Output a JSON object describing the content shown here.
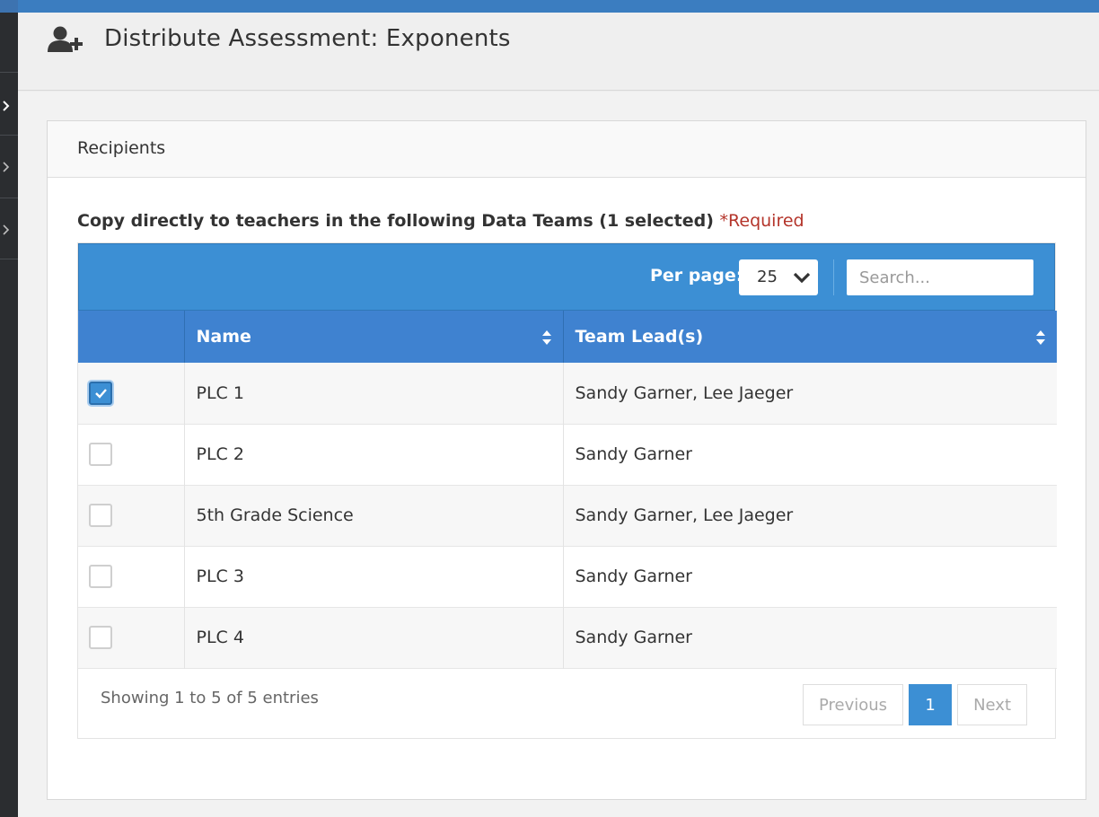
{
  "header": {
    "title": "Distribute Assessment: Exponents",
    "icon": "add-user-icon"
  },
  "panel": {
    "heading": "Recipients",
    "instruction": "Copy directly to teachers in the following Data Teams (1 selected)",
    "required_label": "*Required"
  },
  "toolbar": {
    "per_page_label": "Per page:",
    "per_page_value": "25",
    "search_placeholder": "Search..."
  },
  "table": {
    "columns": [
      "Name",
      "Team Lead(s)"
    ],
    "rows": [
      {
        "checked": true,
        "name": "PLC 1",
        "leads": "Sandy Garner, Lee Jaeger"
      },
      {
        "checked": false,
        "name": "PLC 2",
        "leads": "Sandy Garner"
      },
      {
        "checked": false,
        "name": "5th Grade Science",
        "leads": "Sandy Garner, Lee Jaeger"
      },
      {
        "checked": false,
        "name": "PLC 3",
        "leads": "Sandy Garner"
      },
      {
        "checked": false,
        "name": "PLC 4",
        "leads": "Sandy Garner"
      }
    ]
  },
  "footer": {
    "info": "Showing 1 to 5 of 5 entries",
    "previous": "Previous",
    "page": "1",
    "next": "Next"
  },
  "colors": {
    "accent": "#3c8fd4",
    "header_row": "#3f82d0",
    "required": "#b4342a"
  }
}
